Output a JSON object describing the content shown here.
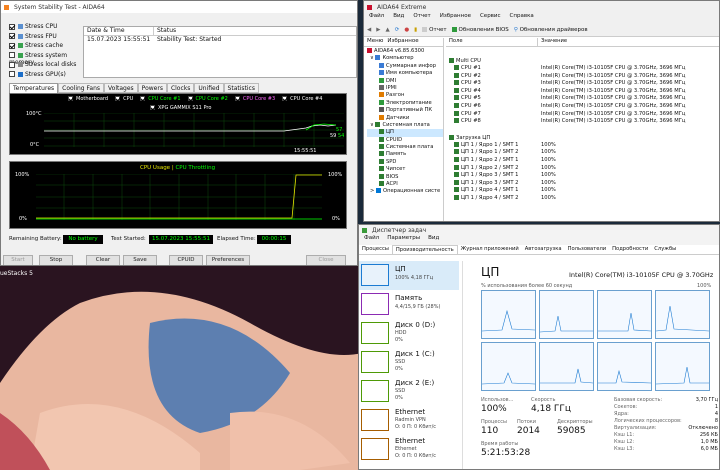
{
  "stability": {
    "title": "System Stability Test - AIDA64",
    "options": [
      {
        "label": "Stress CPU",
        "checked": true
      },
      {
        "label": "Stress FPU",
        "checked": true
      },
      {
        "label": "Stress cache",
        "checked": true
      },
      {
        "label": "Stress system memory",
        "checked": false
      },
      {
        "label": "Stress local disks",
        "checked": false
      },
      {
        "label": "Stress GPU(s)",
        "checked": false
      }
    ],
    "log_head": {
      "date": "Date & Time",
      "status": "Status"
    },
    "log_row": {
      "date": "15.07.2023 15:55:51",
      "status": "Stability Test: Started"
    },
    "tabs": [
      "Temperatures",
      "Cooling Fans",
      "Voltages",
      "Powers",
      "Clocks",
      "Unified",
      "Statistics"
    ],
    "legend": [
      {
        "label": "Motherboard",
        "color": "#ffffff"
      },
      {
        "label": "CPU",
        "color": "#ffffff"
      },
      {
        "label": "CPU Core #1",
        "color": "#00ff00"
      },
      {
        "label": "CPU Core #2",
        "color": "#00ff00"
      },
      {
        "label": "CPU Core #3",
        "color": "#ff66ff"
      },
      {
        "label": "CPU Core #4",
        "color": "#ffffff"
      }
    ],
    "legend2": "XPG GAMMIX S11 Pro",
    "temp_ytop": "100°C",
    "temp_ybot": "0°C",
    "temp_time": "15:55:51",
    "temp_vals": [
      "57",
      "59",
      "54"
    ],
    "usage_title": "CPU Usage",
    "throttle_title": "CPU Throttling",
    "usage_ytop": "100%",
    "usage_ybot": "0%",
    "usage_rtop": "100%",
    "usage_rbot": "0%",
    "battery_label": "Remaining Battery:",
    "battery_val": "No battery",
    "started_label": "Test Started:",
    "started_val": "15.07.2023 15:55:51",
    "elapsed_label": "Elapsed Time:",
    "elapsed_val": "00:00:15",
    "buttons": {
      "start": "Start",
      "stop": "Stop",
      "clear": "Clear",
      "save": "Save",
      "cpuid": "CPUID",
      "prefs": "Preferences",
      "close": "Close"
    }
  },
  "desktop": {
    "bluestacks_label": "ueStacks 5"
  },
  "aida": {
    "title": "AIDA64 Extreme",
    "menu": [
      "Меню",
      "Избранное"
    ],
    "menubar": [
      "Файл",
      "Вид",
      "Отчет",
      "Избранное",
      "Сервис",
      "Справка"
    ],
    "toolbar": {
      "report": "Отчет",
      "bios": "Обновления BIOS",
      "drivers": "Обновления драйверов"
    },
    "version": "AIDA64 v6.85.6300",
    "tree": [
      "Компьютер",
      "Суммарная инфор",
      "Имя компьютера",
      "DMI",
      "IPMI",
      "Разгон",
      "Электропитание",
      "Портативный ПК",
      "Датчики",
      "Системная плата",
      "ЦП",
      "CPUID",
      "Системная плата",
      "Память",
      "SPD",
      "Чипсет",
      "BIOS",
      "ACPI",
      "Операционная систе"
    ],
    "col_field": "Поле",
    "col_value": "Значение",
    "multi_cpu": "Multi CPU",
    "cpu_names": [
      "CPU #1",
      "CPU #2",
      "CPU #3",
      "CPU #4",
      "CPU #5",
      "CPU #6",
      "CPU #7",
      "CPU #8"
    ],
    "cpu_value": "Intel(R) Core(TM) i3-10105F CPU @ 3.70GHz, 3696 МГц",
    "load_title": "Загрузка ЦП",
    "load_rows": [
      {
        "name": "ЦП 1 / Ядро 1 / SMT 1",
        "value": "100%"
      },
      {
        "name": "ЦП 1 / Ядро 1 / SMT 2",
        "value": "100%"
      },
      {
        "name": "ЦП 1 / Ядро 2 / SMT 1",
        "value": "100%"
      },
      {
        "name": "ЦП 1 / Ядро 2 / SMT 2",
        "value": "100%"
      },
      {
        "name": "ЦП 1 / Ядро 3 / SMT 1",
        "value": "100%"
      },
      {
        "name": "ЦП 1 / Ядро 3 / SMT 2",
        "value": "100%"
      },
      {
        "name": "ЦП 1 / Ядро 4 / SMT 1",
        "value": "100%"
      },
      {
        "name": "ЦП 1 / Ядро 4 / SMT 2",
        "value": "100%"
      }
    ]
  },
  "taskmgr": {
    "title": "Диспетчер задач",
    "menu": [
      "Файл",
      "Параметры",
      "Вид"
    ],
    "tabs": [
      "Процессы",
      "Производительность",
      "Журнал приложений",
      "Автозагрузка",
      "Пользователи",
      "Подробности",
      "Службы"
    ],
    "side": [
      {
        "name": "ЦП",
        "sub1": "100% 4,18 ГГц",
        "sub2": "",
        "color": "#1c7bd2"
      },
      {
        "name": "Память",
        "sub1": "4,4/15,9 ГБ (28%)",
        "sub2": "",
        "color": "#8b2bb3"
      },
      {
        "name": "Диск 0 (D:)",
        "sub1": "HDD",
        "sub2": "0%",
        "color": "#4e9a06"
      },
      {
        "name": "Диск 1 (C:)",
        "sub1": "SSD",
        "sub2": "0%",
        "color": "#4e9a06"
      },
      {
        "name": "Диск 2 (E:)",
        "sub1": "SSD",
        "sub2": "0%",
        "color": "#4e9a06"
      },
      {
        "name": "Ethernet",
        "sub1": "Radmin VPN",
        "sub2": "О: 0 П: 0 Кбит/с",
        "color": "#a65d00"
      },
      {
        "name": "Ethernet",
        "sub1": "Ethernet",
        "sub2": "О: 0 П: 0 Кбит/с",
        "color": "#a65d00"
      }
    ],
    "heading": "ЦП",
    "cpu_model": "Intel(R) Core(TM) i3-10105F CPU @ 3.70GHz",
    "graph_caption": "% использования более 60 секунд",
    "graph_top": "100%",
    "util_label": "Использов...",
    "util_val": "100%",
    "speed_label": "Скорость",
    "speed_val": "4,18 ГГц",
    "proc_label": "Процессы",
    "proc_val": "110",
    "threads_label": "Потоки",
    "threads_val": "2014",
    "handles_label": "Дескрипторы",
    "handles_val": "59085",
    "uptime_label": "Время работы",
    "uptime_val": "5:21:53:28",
    "specs": [
      {
        "k": "Базовая скорость:",
        "v": "3,70 ГГц"
      },
      {
        "k": "Сокетов:",
        "v": "1"
      },
      {
        "k": "Ядра:",
        "v": "4"
      },
      {
        "k": "Логических процессоров:",
        "v": "8"
      },
      {
        "k": "Виртуализация:",
        "v": "Отключено"
      },
      {
        "k": "Кэш L1:",
        "v": "256 КБ"
      },
      {
        "k": "Кэш L2:",
        "v": "1,0 МБ"
      },
      {
        "k": "Кэш L3:",
        "v": "6,0 МБ"
      }
    ]
  }
}
